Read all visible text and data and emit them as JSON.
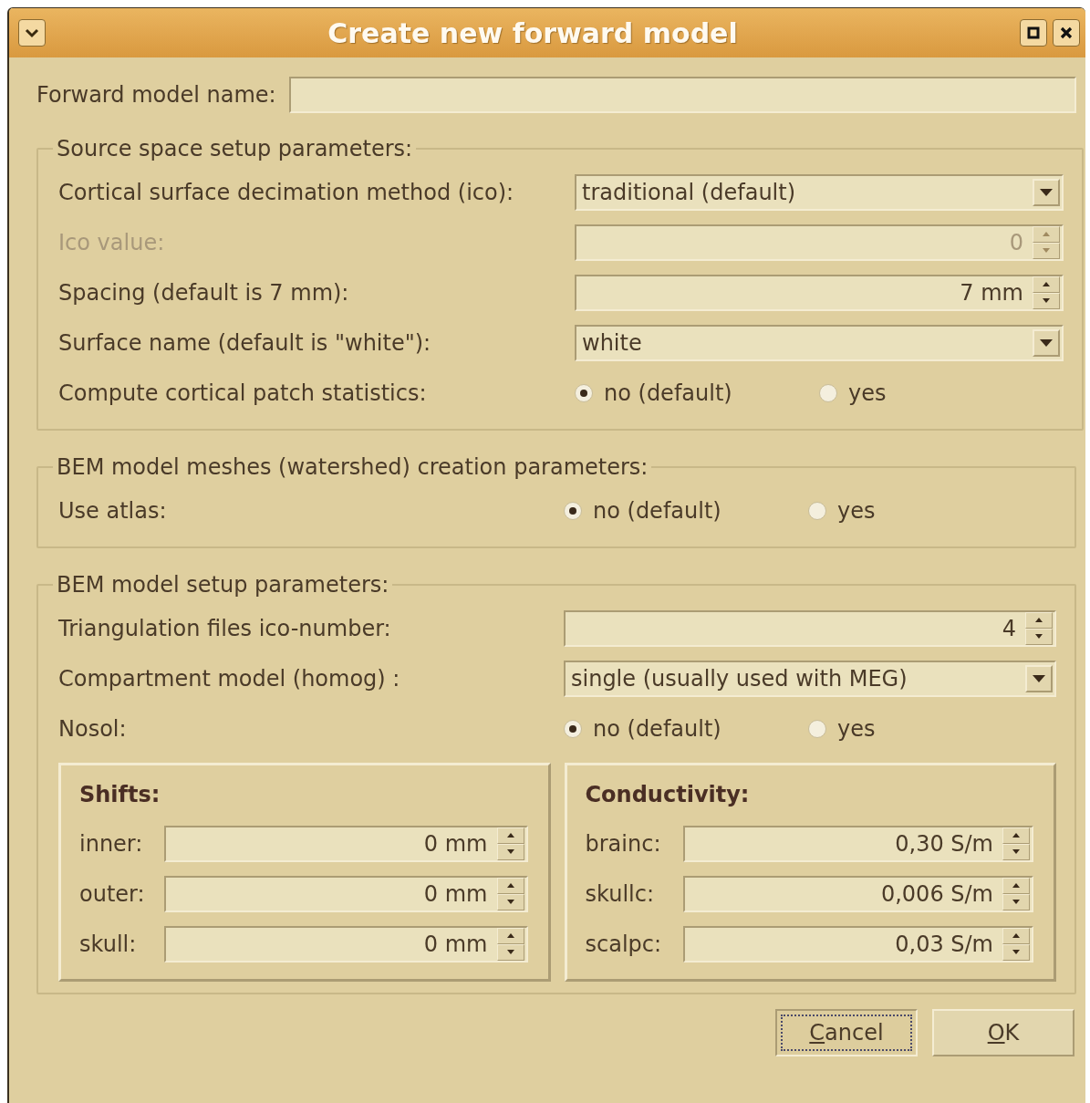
{
  "window": {
    "title": "Create new forward model"
  },
  "name_field": {
    "label": "Forward model name:"
  },
  "groups": [
    {
      "title": "Source space setup parameters:",
      "rows": [
        {
          "kind": "combo",
          "label": "Cortical surface decimation method (ico):",
          "value": "traditional (default)",
          "disabled": false
        },
        {
          "kind": "spin",
          "label": "Ico value:",
          "value": "0",
          "disabled": true
        },
        {
          "kind": "spin",
          "label": "Spacing (default is 7 mm):",
          "value": "7 mm",
          "disabled": false
        },
        {
          "kind": "combo",
          "label": "Surface name (default is \"white\"):",
          "value": "white",
          "disabled": false
        },
        {
          "kind": "radio",
          "label": "Compute cortical patch statistics:",
          "disabled": false,
          "options": [
            {
              "label": "no (default)",
              "selected": true
            },
            {
              "label": "yes",
              "selected": false
            }
          ]
        }
      ]
    },
    {
      "title": "BEM model meshes (watershed) creation parameters:",
      "rows": [
        {
          "kind": "radio",
          "label": "Use atlas:",
          "disabled": false,
          "options": [
            {
              "label": "no (default)",
              "selected": true
            },
            {
              "label": "yes",
              "selected": false
            }
          ]
        }
      ]
    },
    {
      "title": "BEM model setup parameters:",
      "rows": [
        {
          "kind": "spin",
          "label": "Triangulation files ico-number:",
          "value": "4",
          "disabled": false
        },
        {
          "kind": "combo",
          "label": "Compartment model (homog) :",
          "value": "single (usually used with MEG)",
          "disabled": false
        },
        {
          "kind": "radio",
          "label": "Nosol:",
          "disabled": false,
          "options": [
            {
              "label": "no (default)",
              "selected": true
            },
            {
              "label": "yes",
              "selected": false
            }
          ]
        }
      ],
      "panels": [
        {
          "title": "Shifts:",
          "fields": [
            {
              "label": "inner:",
              "value": "0 mm"
            },
            {
              "label": "outer:",
              "value": "0 mm"
            },
            {
              "label": "skull:",
              "value": "0 mm"
            }
          ]
        },
        {
          "title": "Conductivity:",
          "fields": [
            {
              "label": "brainc:",
              "value": "0,30 S/m"
            },
            {
              "label": "skullc:",
              "value": "0,006 S/m"
            },
            {
              "label": "scalpc:",
              "value": "0,03 S/m"
            }
          ]
        }
      ]
    }
  ],
  "buttons": [
    {
      "label": "Cancel",
      "focused": true,
      "mnemonic_first": true
    },
    {
      "label": "OK",
      "focused": false,
      "mnemonic_first": true
    }
  ]
}
